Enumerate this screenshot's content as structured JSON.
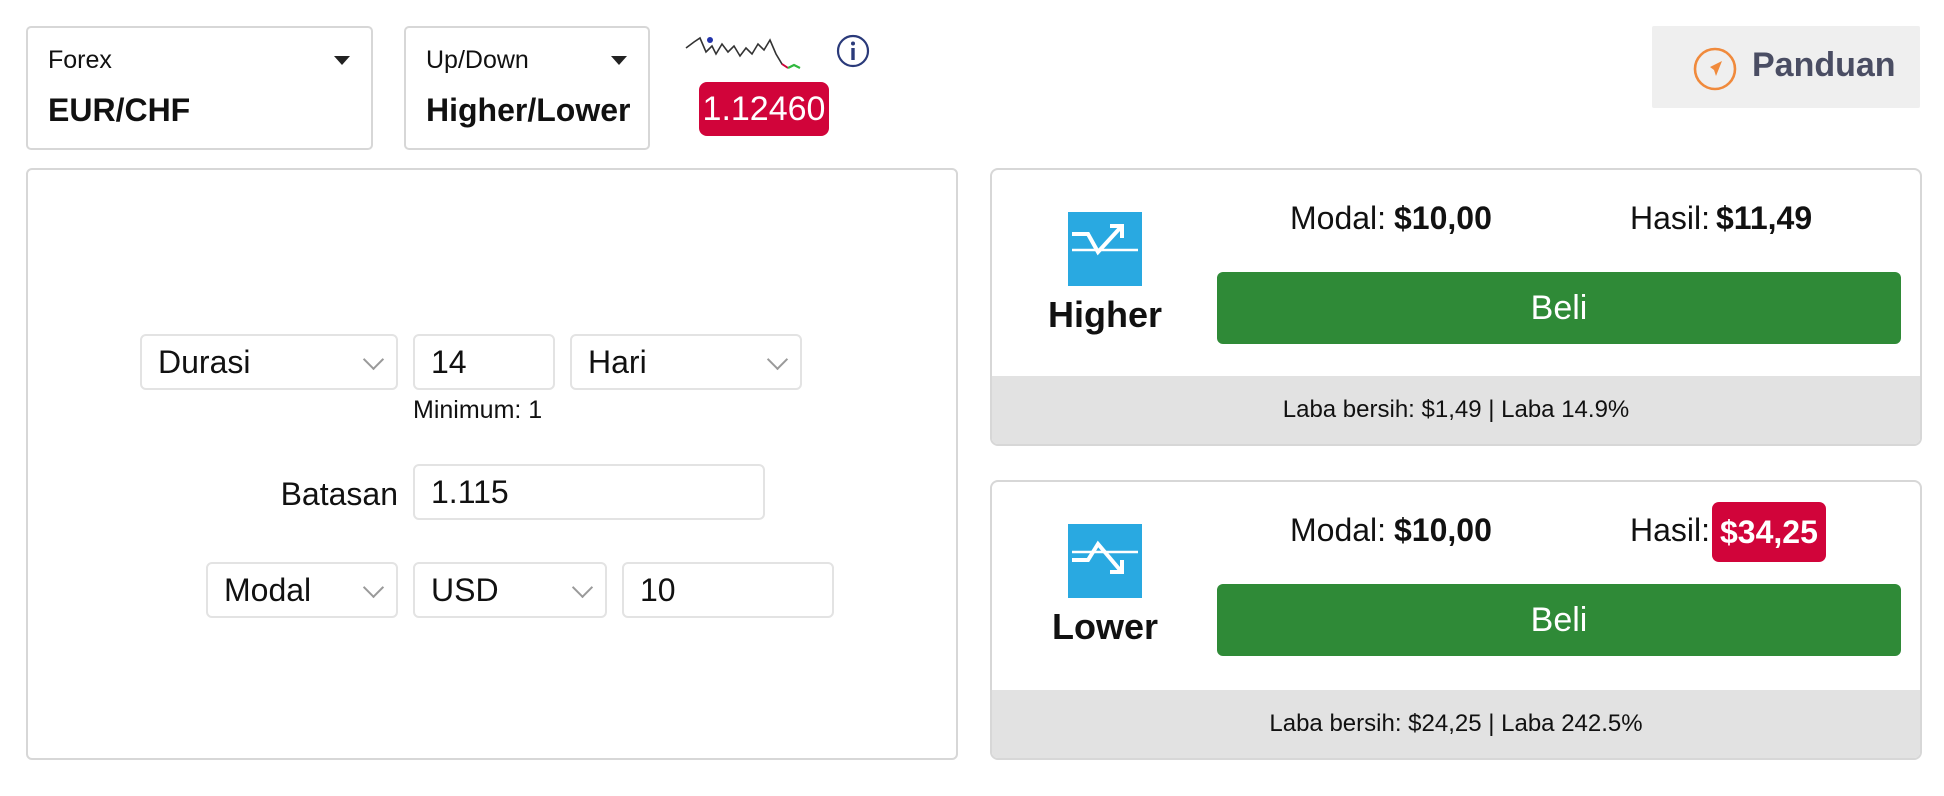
{
  "market": {
    "category": "Forex",
    "pair": "EUR/CHF"
  },
  "option": {
    "category": "Up/Down",
    "type": "Higher/Lower"
  },
  "price": {
    "current": "1.12460"
  },
  "guide": {
    "label": "Panduan"
  },
  "form": {
    "duration_select": "Durasi",
    "duration_value": "14",
    "duration_unit": "Hari",
    "minimum_hint": "Minimum: 1",
    "barrier_label": "Batasan",
    "barrier_value": "1.115",
    "amount_select": "Modal",
    "currency": "USD",
    "amount_value": "10"
  },
  "contracts": [
    {
      "direction": "Higher",
      "stake_label": "Modal:",
      "stake_value": "$10,00",
      "payout_label": "Hasil:",
      "payout_value": "$11,49",
      "buy_label": "Beli",
      "footer": "Laba bersih: $1,49 | Laba 14.9%"
    },
    {
      "direction": "Lower",
      "stake_label": "Modal:",
      "stake_value": "$10,00",
      "payout_label": "Hasil:",
      "payout_value": "$34,25",
      "buy_label": "Beli",
      "footer": "Laba bersih: $24,25 | Laba 242.5%"
    }
  ],
  "colors": {
    "accent_red": "#d1043a",
    "buy_green": "#2f8a37",
    "icon_blue": "#29a9e1",
    "guide_orange": "#f08a3c"
  },
  "icons": {
    "market_dropdown": "caret-down-icon",
    "option_dropdown": "caret-down-icon",
    "info": "info-icon",
    "guide": "compass-icon",
    "higher": "trend-up-icon",
    "lower": "trend-down-icon"
  }
}
